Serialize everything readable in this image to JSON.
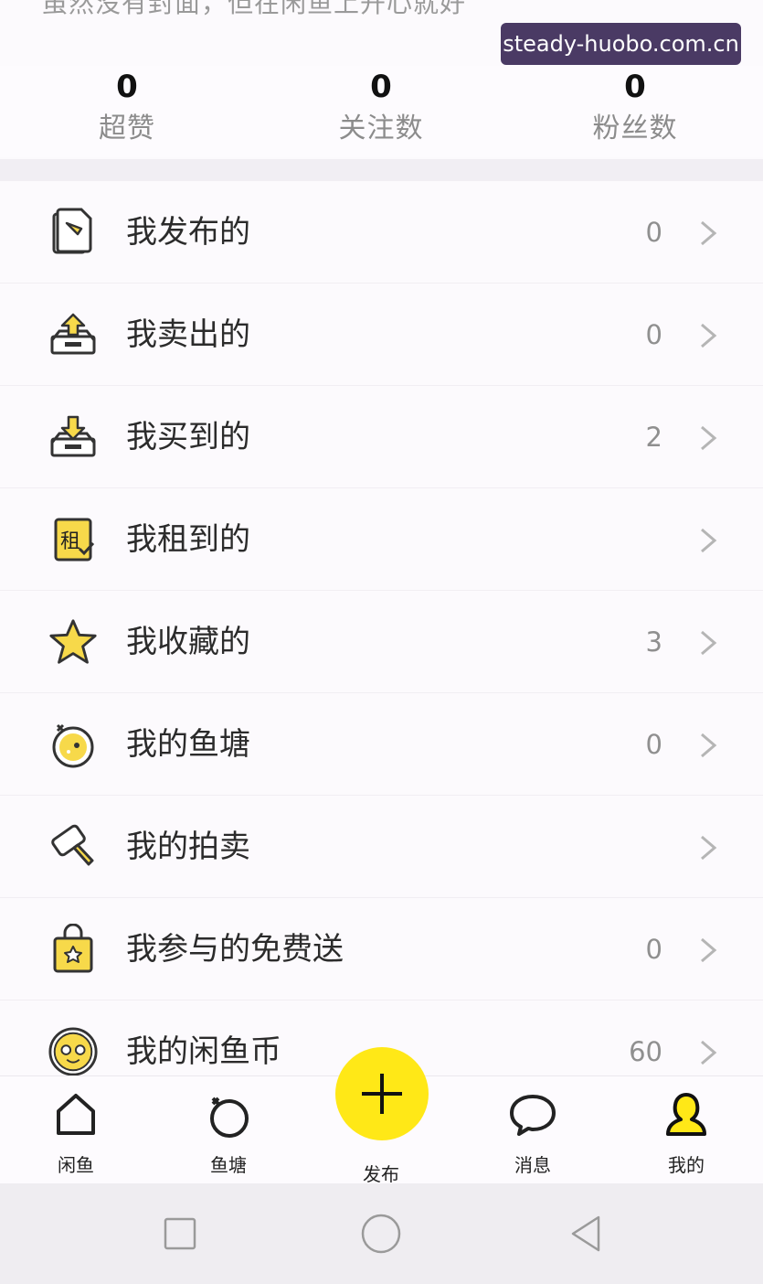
{
  "watermark": "steady-huobo.com.cn",
  "cropped_text": "虽然没有封面，但在闲鱼上开心就好",
  "stats": [
    {
      "value": "0",
      "label": "超赞"
    },
    {
      "value": "0",
      "label": "关注数"
    },
    {
      "value": "0",
      "label": "粉丝数"
    }
  ],
  "menu": [
    {
      "label": "我发布的",
      "count": "0",
      "icon": "published-document-icon"
    },
    {
      "label": "我卖出的",
      "count": "0",
      "icon": "sold-upload-box-icon"
    },
    {
      "label": "我买到的",
      "count": "2",
      "icon": "bought-download-box-icon"
    },
    {
      "label": "我租到的",
      "count": "",
      "icon": "rent-badge-icon",
      "icon_text": "租"
    },
    {
      "label": "我收藏的",
      "count": "3",
      "icon": "star-icon"
    },
    {
      "label": "我的鱼塘",
      "count": "0",
      "icon": "fish-pond-icon"
    },
    {
      "label": "我的拍卖",
      "count": "",
      "icon": "auction-hammer-icon"
    },
    {
      "label": "我参与的免费送",
      "count": "0",
      "icon": "free-gift-bag-icon"
    },
    {
      "label": "我的闲鱼币",
      "count": "60",
      "icon": "xianyu-coin-icon"
    }
  ],
  "tabs": [
    {
      "label": "闲鱼",
      "icon": "home-icon"
    },
    {
      "label": "鱼塘",
      "icon": "pond-ring-icon"
    },
    {
      "label": "发布",
      "icon": "plus-icon"
    },
    {
      "label": "消息",
      "icon": "message-bubble-icon"
    },
    {
      "label": "我的",
      "icon": "profile-icon"
    }
  ],
  "colors": {
    "accent_yellow": "#ffe817",
    "icon_yellow": "#f7d94a",
    "text_primary": "#2b2b2b",
    "text_secondary": "#8f8f8f",
    "watermark_bg": "#4a3a64"
  }
}
